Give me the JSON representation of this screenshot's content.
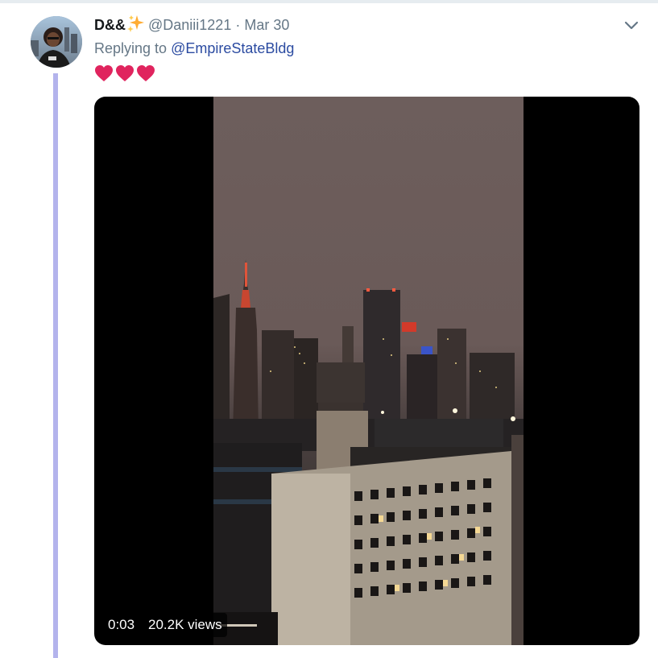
{
  "tweet": {
    "display_name": "D&&",
    "handle": "@Daniii1221",
    "separator": "·",
    "date": "Mar 30",
    "reply_prefix": "Replying to",
    "reply_to": "@EmpireStateBldg",
    "hearts": [
      "heart-icon",
      "heart-icon",
      "heart-icon"
    ]
  },
  "media": {
    "duration": "0:03",
    "views": "20.2K views"
  },
  "colors": {
    "thread_line": "#b3b3ec",
    "heart": "#e0245e",
    "link": "#2b4ba1",
    "muted": "#657786",
    "sparkle": "#ffac33"
  }
}
